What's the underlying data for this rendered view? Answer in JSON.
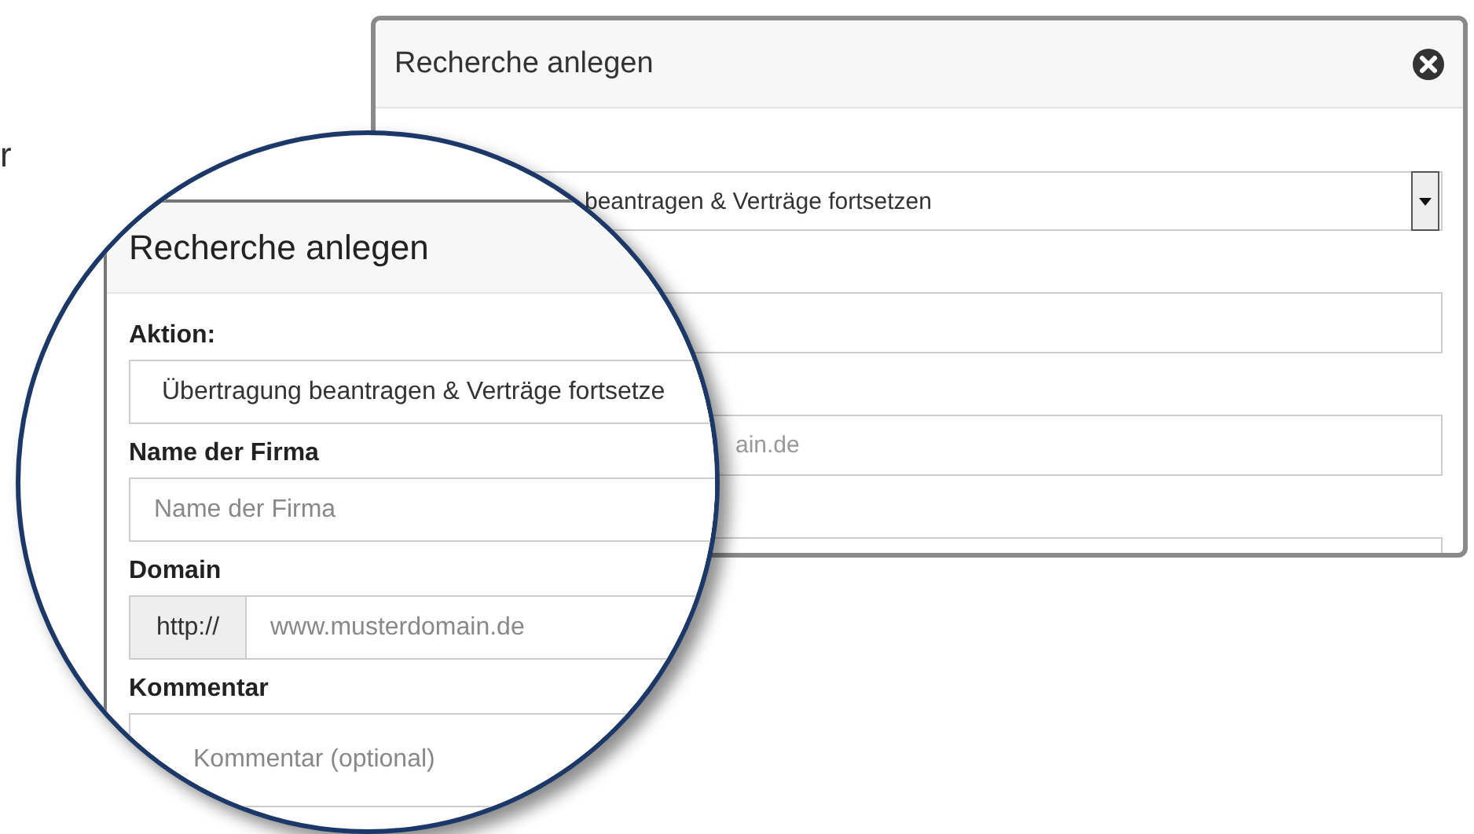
{
  "page_fragment": {
    "text": "r"
  },
  "back_dialog": {
    "title": "Recherche anlegen",
    "action_value": "beantragen & Verträge fortsetzen",
    "domain_placeholder": "ain.de"
  },
  "magnified_dialog": {
    "title": "Recherche anlegen",
    "fields": [
      {
        "kind": "select",
        "label": "Aktion:",
        "value": "Übertragung beantragen & Verträge fortsetze"
      },
      {
        "kind": "text",
        "label": "Name der Firma",
        "placeholder": "Name der Firma"
      },
      {
        "kind": "addon",
        "label": "Domain",
        "addon": "http://",
        "placeholder": "www.musterdomain.de"
      },
      {
        "kind": "textarea",
        "label": "Kommentar",
        "placeholder": "Kommentar (optional)"
      }
    ]
  }
}
